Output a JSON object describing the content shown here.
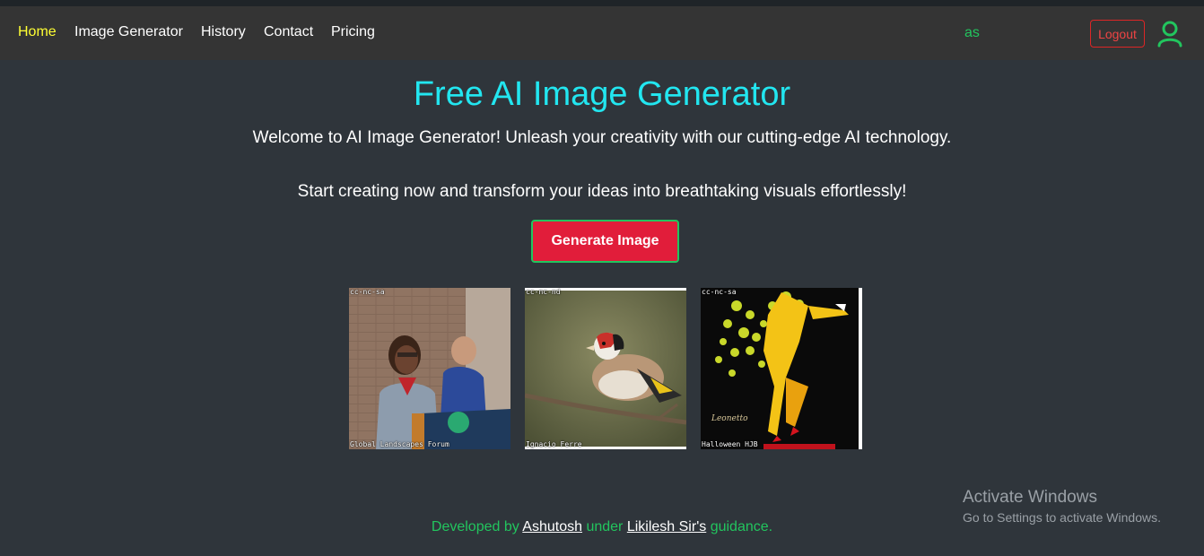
{
  "nav": {
    "links": [
      "Home",
      "Image Generator",
      "History",
      "Contact",
      "Pricing"
    ],
    "active": "Home",
    "username": "as",
    "logout_label": "Logout",
    "user_icon": "user-icon"
  },
  "hero": {
    "title": "Free AI Image Generator",
    "subtitle_1": "Welcome to AI Image Generator! Unleash your creativity with our cutting-edge AI technology.",
    "subtitle_2": "Start creating now and transform your ideas into breathtaking visuals effortlessly!",
    "cta_label": "Generate Image"
  },
  "gallery": [
    {
      "license": "cc-nc-sa",
      "credit": "Global Landscapes Forum"
    },
    {
      "license": "cc-nc-nd",
      "credit": "Ignacio Ferre"
    },
    {
      "license": "cc-nc-sa",
      "credit": "Halloween HJB"
    }
  ],
  "footer": {
    "prefix": "Developed by ",
    "author": "Ashutosh",
    "middle": " under ",
    "mentor": "Likilesh Sir's",
    "suffix": " guidance."
  },
  "watermark": {
    "title": "Activate Windows",
    "subtitle": "Go to Settings to activate Windows."
  },
  "colors": {
    "accent_cyan": "#22e6f0",
    "active_nav": "#ffff33",
    "green": "#22c55e",
    "red": "#e11d3a"
  }
}
